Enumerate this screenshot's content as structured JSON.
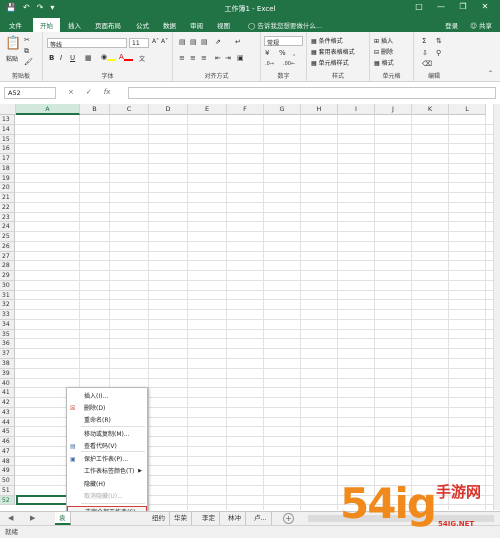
{
  "app": {
    "window_title": "工作簿1 - Excel",
    "colors": {
      "accent": "#217346",
      "selection_outline": "#d0403f"
    }
  },
  "title_bar": {
    "qat": [
      "save-icon",
      "undo-icon",
      "redo-icon",
      "customize-icon"
    ],
    "window_controls": [
      "ribbon-display-icon",
      "minimize-icon",
      "restore-icon",
      "close-icon"
    ]
  },
  "ribbon_tabs": {
    "items": [
      "文件",
      "开始",
      "插入",
      "页面布局",
      "公式",
      "数据",
      "审阅",
      "视图"
    ],
    "active": "开始",
    "tell_me": "告诉我您想要做什么...",
    "sign_in": "登录",
    "share": "共享"
  },
  "ribbon": {
    "clipboard": {
      "label": "剪贴板",
      "paste": "粘贴"
    },
    "font": {
      "label": "字体",
      "font_name": "等线",
      "font_size": "11",
      "bold": "B",
      "italic": "I",
      "underline": "U",
      "wen": "文"
    },
    "alignment": {
      "label": "对齐方式"
    },
    "number": {
      "label": "数字",
      "format": "常规",
      "percent": "%",
      "comma": ","
    },
    "styles": {
      "label": "样式",
      "conditional": "条件格式",
      "table": "套用表格格式",
      "cell_styles": "单元格样式"
    },
    "cells": {
      "label": "单元格",
      "insert": "插入",
      "delete": "删除",
      "format": "格式"
    },
    "editing": {
      "label": "编辑"
    }
  },
  "formula_bar": {
    "name_box": "A52",
    "cancel": "×",
    "enter": "✓",
    "fx": "fx"
  },
  "grid": {
    "columns": [
      "A",
      "B",
      "C",
      "D",
      "E",
      "F",
      "G",
      "H",
      "I",
      "J",
      "K",
      "L"
    ],
    "selected_column": "A",
    "rows": [
      "13",
      "14",
      "15",
      "16",
      "17",
      "18",
      "19",
      "20",
      "21",
      "22",
      "23",
      "24",
      "25",
      "26",
      "27",
      "28",
      "29",
      "30",
      "31",
      "32",
      "33",
      "34",
      "35",
      "36",
      "37",
      "38",
      "39",
      "40",
      "41",
      "42",
      "43",
      "44",
      "45",
      "46",
      "47",
      "48",
      "49",
      "50",
      "51",
      "52"
    ],
    "selected_row": "52"
  },
  "context_menu": {
    "items": [
      {
        "label": "插入(I)...",
        "icon": "",
        "disabled": false
      },
      {
        "label": "删除(D)",
        "icon": "delete-sheet-icon",
        "disabled": false
      },
      {
        "label": "重命名(R)",
        "icon": "",
        "disabled": false
      },
      {
        "label": "移动或复制(M)...",
        "icon": "",
        "disabled": false
      },
      {
        "label": "查看代码(V)",
        "icon": "view-code-icon",
        "disabled": false
      },
      {
        "label": "保护工作表(P)...",
        "icon": "protect-sheet-icon",
        "disabled": false
      },
      {
        "label": "工作表标签颜色(T)",
        "icon": "",
        "disabled": false,
        "submenu": true
      },
      {
        "label": "隐藏(H)",
        "icon": "",
        "disabled": false
      },
      {
        "label": "取消隐藏(U)...",
        "icon": "",
        "disabled": true
      },
      {
        "label": "选定全部工作表(S)",
        "icon": "",
        "disabled": false,
        "highlight": true
      }
    ]
  },
  "sheet_tabs": {
    "tabs": [
      "袁",
      "纽约",
      "华荣",
      "李定",
      "林冲",
      "卢..."
    ],
    "active_index": 0,
    "add": "+"
  },
  "status_bar": {
    "text": "就绪"
  },
  "watermark": {
    "big": "54ig",
    "cn": "手游网",
    "url": "54IG.NET"
  }
}
